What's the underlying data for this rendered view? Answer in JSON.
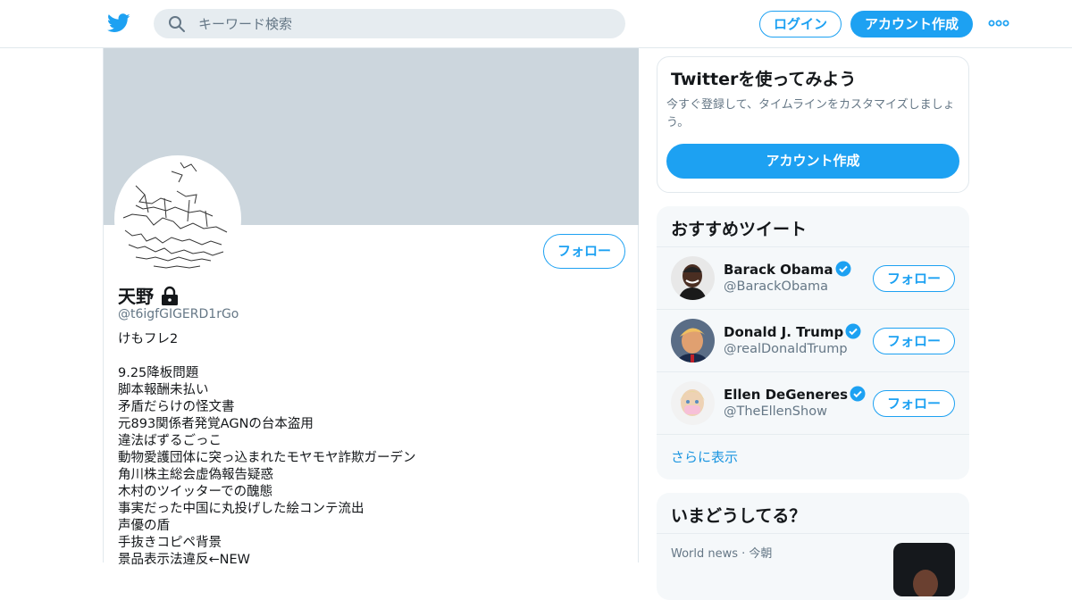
{
  "header": {
    "search_placeholder": "キーワード検索",
    "login_label": "ログイン",
    "signup_label": "アカウント作成"
  },
  "profile": {
    "name": "天野",
    "handle": "@t6igfGIGERD1rGo",
    "follow_label": "フォロー",
    "bio_first": "けもフレ2",
    "bio_lines": [
      "9.25降板問題",
      "脚本報酬未払い",
      "矛盾だらけの怪文書",
      "元893関係者発覚AGNの台本盗用",
      "違法ばずるごっこ",
      "動物愛護団体に突っ込まれたモヤモヤ詐欺ガーデン",
      "角川株主総会虚偽報告疑惑",
      "木村のツイッターでの醜態",
      "事実だった中国に丸投げした絵コンテ流出",
      "声優の盾",
      "手抜きコピペ背景",
      "景品表示法違反←NEW"
    ]
  },
  "signup_card": {
    "title": "Twitterを使ってみよう",
    "description": "今すぐ登録して、タイムラインをカスタマイズしましょう。",
    "button_label": "アカウント作成"
  },
  "recommend": {
    "title": "おすすめツイート",
    "users": [
      {
        "name": "Barack Obama",
        "handle": "@BarackObama",
        "follow_label": "フォロー"
      },
      {
        "name": "Donald J. Trump",
        "handle": "@realDonaldTrump",
        "follow_label": "フォロー"
      },
      {
        "name": "Ellen DeGeneres",
        "handle": "@TheEllenShow",
        "follow_label": "フォロー"
      }
    ],
    "show_more": "さらに表示"
  },
  "trends": {
    "title": "いまどうしてる？",
    "first_meta": "World news · 今朝"
  },
  "colors": {
    "accent": "#1da1f2",
    "banner": "#ccd6dd",
    "muted_text": "#657786",
    "panel_bg": "#f5f8fa"
  },
  "icons": [
    "twitter-logo-icon",
    "search-icon",
    "more-dots-icon",
    "lock-icon",
    "verified-badge-icon"
  ]
}
